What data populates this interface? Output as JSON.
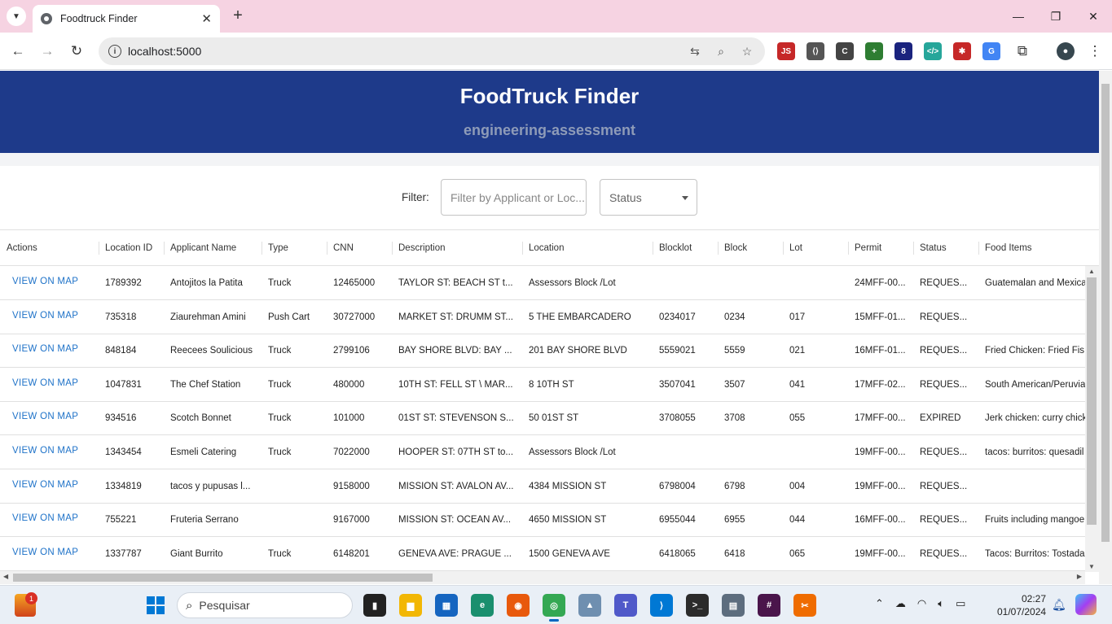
{
  "browser": {
    "tab_title": "Foodtruck Finder",
    "new_tab": "+",
    "url": "localhost:5000",
    "window_controls": {
      "minimize": "—",
      "maximize": "❐",
      "close": "✕"
    },
    "tab_close": "✕",
    "extensions": [
      {
        "name": "js-extension-icon",
        "label": "JS",
        "color": "#c62828"
      },
      {
        "name": "devtools-extension-icon",
        "label": "⟨⟩",
        "color": "#555555"
      },
      {
        "name": "css-extension-icon",
        "label": "C",
        "color": "#444444"
      },
      {
        "name": "plus-extension-icon",
        "label": "+",
        "color": "#2e7d32"
      },
      {
        "name": "shield-extension-icon",
        "label": "8",
        "color": "#1a237e"
      },
      {
        "name": "code-extension-icon",
        "label": "</>",
        "color": "#26a69a"
      },
      {
        "name": "bug-extension-icon",
        "label": "✱",
        "color": "#c62828"
      },
      {
        "name": "translate-extension-icon",
        "label": "G",
        "color": "#4285f4"
      }
    ]
  },
  "app": {
    "title": "FoodTruck Finder",
    "subtitle": "engineering-assessment",
    "filter_label": "Filter:",
    "filter_placeholder": "Filter by Applicant or Loc...",
    "status_label": "Status"
  },
  "grid": {
    "columns": [
      "Actions",
      "Location ID",
      "Applicant Name",
      "Type",
      "CNN",
      "Description",
      "Location",
      "Blocklot",
      "Block",
      "Lot",
      "Permit",
      "Status",
      "Food Items"
    ],
    "action_label": "VIEW ON MAP",
    "rows": [
      [
        "1789392",
        "Antojitos la Patita",
        "Truck",
        "12465000",
        "TAYLOR ST: BEACH ST t...",
        "Assessors Block /Lot",
        "",
        "",
        "",
        "24MFF-00...",
        "REQUES...",
        "Guatemalan and Mexica"
      ],
      [
        "735318",
        "Ziaurehman Amini",
        "Push Cart",
        "30727000",
        "MARKET ST: DRUMM ST...",
        "5 THE EMBARCADERO",
        "0234017",
        "0234",
        "017",
        "15MFF-01...",
        "REQUES...",
        ""
      ],
      [
        "848184",
        "Reecees Soulicious",
        "Truck",
        "2799106",
        "BAY SHORE BLVD: BAY ...",
        "201 BAY SHORE BLVD",
        "5559021",
        "5559",
        "021",
        "16MFF-01...",
        "REQUES...",
        "Fried Chicken: Fried Fis"
      ],
      [
        "1047831",
        "The Chef Station",
        "Truck",
        "480000",
        "10TH ST: FELL ST \\ MAR...",
        "8 10TH ST",
        "3507041",
        "3507",
        "041",
        "17MFF-02...",
        "REQUES...",
        "South American/Peruvia"
      ],
      [
        "934516",
        "Scotch Bonnet",
        "Truck",
        "101000",
        "01ST ST: STEVENSON S...",
        "50 01ST ST",
        "3708055",
        "3708",
        "055",
        "17MFF-00...",
        "EXPIRED",
        "Jerk chicken: curry chick"
      ],
      [
        "1343454",
        "Esmeli Catering",
        "Truck",
        "7022000",
        "HOOPER ST: 07TH ST to...",
        "Assessors Block /Lot",
        "",
        "",
        "",
        "19MFF-00...",
        "REQUES...",
        "tacos: burritos: quesadil"
      ],
      [
        "1334819",
        "tacos y pupusas l...",
        "",
        "9158000",
        "MISSION ST: AVALON AV...",
        "4384 MISSION ST",
        "6798004",
        "6798",
        "004",
        "19MFF-00...",
        "REQUES...",
        ""
      ],
      [
        "755221",
        "Fruteria Serrano",
        "",
        "9167000",
        "MISSION ST: OCEAN AV...",
        "4650 MISSION ST",
        "6955044",
        "6955",
        "044",
        "16MFF-00...",
        "REQUES...",
        "Fruits including mangoe"
      ],
      [
        "1337787",
        "Giant Burrito",
        "Truck",
        "6148201",
        "GENEVA AVE: PRAGUE ...",
        "1500 GENEVA AVE",
        "6418065",
        "6418",
        "065",
        "19MFF-00...",
        "REQUES...",
        "Tacos: Burritos: Tostada"
      ]
    ]
  },
  "taskbar": {
    "notification_count": "1",
    "search_placeholder": "Pesquisar",
    "time": "02:27",
    "date": "01/07/2024",
    "apps": [
      {
        "name": "terminal-app-icon",
        "label": "▮",
        "color": "#222222"
      },
      {
        "name": "file-explorer-icon",
        "label": "▆",
        "color": "#f2b705"
      },
      {
        "name": "store-icon",
        "label": "▦",
        "color": "#1565c0"
      },
      {
        "name": "edge-icon",
        "label": "e",
        "color": "#1a8f6e"
      },
      {
        "name": "firefox-icon",
        "label": "◉",
        "color": "#e8590c"
      },
      {
        "name": "chrome-icon",
        "label": "◎",
        "color": "#34a853"
      },
      {
        "name": "photos-icon",
        "label": "▲",
        "color": "#6f8fb0"
      },
      {
        "name": "teams-icon",
        "label": "T",
        "color": "#5059c9"
      },
      {
        "name": "vscode-icon",
        "label": "⟩",
        "color": "#0078d4"
      },
      {
        "name": "console-icon",
        "label": ">_",
        "color": "#2b2b2b"
      },
      {
        "name": "calculator-icon",
        "label": "▤",
        "color": "#5d6d7e"
      },
      {
        "name": "slack-icon",
        "label": "#",
        "color": "#4a154b"
      },
      {
        "name": "snipping-tool-icon",
        "label": "✂",
        "color": "#ef6c00"
      }
    ]
  }
}
